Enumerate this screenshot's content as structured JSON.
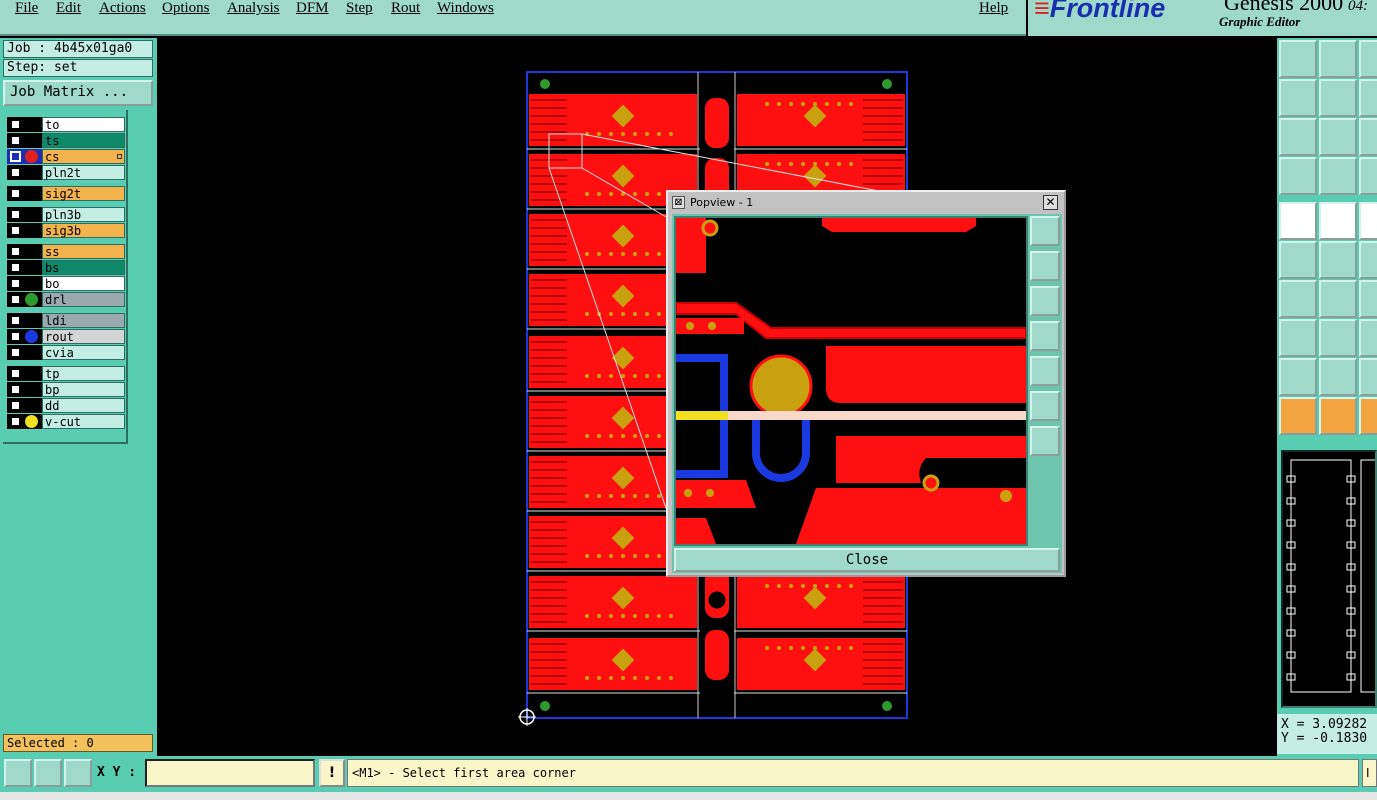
{
  "menu": {
    "items": [
      "File",
      "Edit",
      "Actions",
      "Options",
      "Analysis",
      "DFM",
      "Step",
      "Rout",
      "Windows"
    ],
    "help": "Help"
  },
  "brand": {
    "logo": "Frontline",
    "product": "Genesis 2000",
    "subtitle": "Graphic Editor",
    "clock": "04:"
  },
  "job": {
    "job_label": "Job : 4b45x01ga0",
    "step_label": "Step: set",
    "matrix_button": "Job Matrix ..."
  },
  "layers": [
    {
      "name": "to",
      "color": "#ffffff",
      "dot": "",
      "active": false
    },
    {
      "name": "ts",
      "color": "#0e8a6a",
      "dot": "",
      "active": false
    },
    {
      "name": "cs",
      "color": "#f4b24c",
      "dot": "#e02020",
      "active": true
    },
    {
      "name": "pln2t",
      "color": "#c4ede4",
      "dot": "",
      "active": false
    },
    {
      "name": "sig2t",
      "color": "#f4b24c",
      "dot": "",
      "active": false
    },
    {
      "name": "pln3b",
      "color": "#c4ede4",
      "dot": "",
      "active": false
    },
    {
      "name": "sig3b",
      "color": "#f4b24c",
      "dot": "",
      "active": false
    },
    {
      "name": "ss",
      "color": "#f4b24c",
      "dot": "",
      "active": false
    },
    {
      "name": "bs",
      "color": "#0e8a6a",
      "dot": "",
      "active": false
    },
    {
      "name": "bo",
      "color": "#ffffff",
      "dot": "",
      "active": false
    },
    {
      "name": "drl",
      "color": "#9aa8b0",
      "dot": "#2e9a2e",
      "active": false
    },
    {
      "name": "ldi",
      "color": "#9aa8b0",
      "dot": "",
      "active": false
    },
    {
      "name": "rout",
      "color": "#d4d4d4",
      "dot": "#1a3ae0",
      "active": false
    },
    {
      "name": "cvia",
      "color": "#c4ede4",
      "dot": "",
      "active": false
    },
    {
      "name": "tp",
      "color": "#c4ede4",
      "dot": "",
      "active": false
    },
    {
      "name": "bp",
      "color": "#c4ede4",
      "dot": "",
      "active": false
    },
    {
      "name": "dd",
      "color": "#c4ede4",
      "dot": "",
      "active": false
    },
    {
      "name": "v-cut",
      "color": "#c4ede4",
      "dot": "#f0e020",
      "active": false
    }
  ],
  "selected_label": "Selected : 0",
  "popview": {
    "title": "Popview - 1",
    "close_label": "Close"
  },
  "coords": {
    "x": "X = 3.09282",
    "y": "Y = -0.1830"
  },
  "bottom": {
    "xy_label": "X Y :",
    "xy_value": "",
    "excl": "!",
    "prompt": "<M1> - Select first area corner",
    "right_stub": "I"
  },
  "colors": {
    "panel": "#58cdb1",
    "menubar": "#9ed9c9",
    "copper": "#ff1010",
    "pad": "#c8a010"
  }
}
